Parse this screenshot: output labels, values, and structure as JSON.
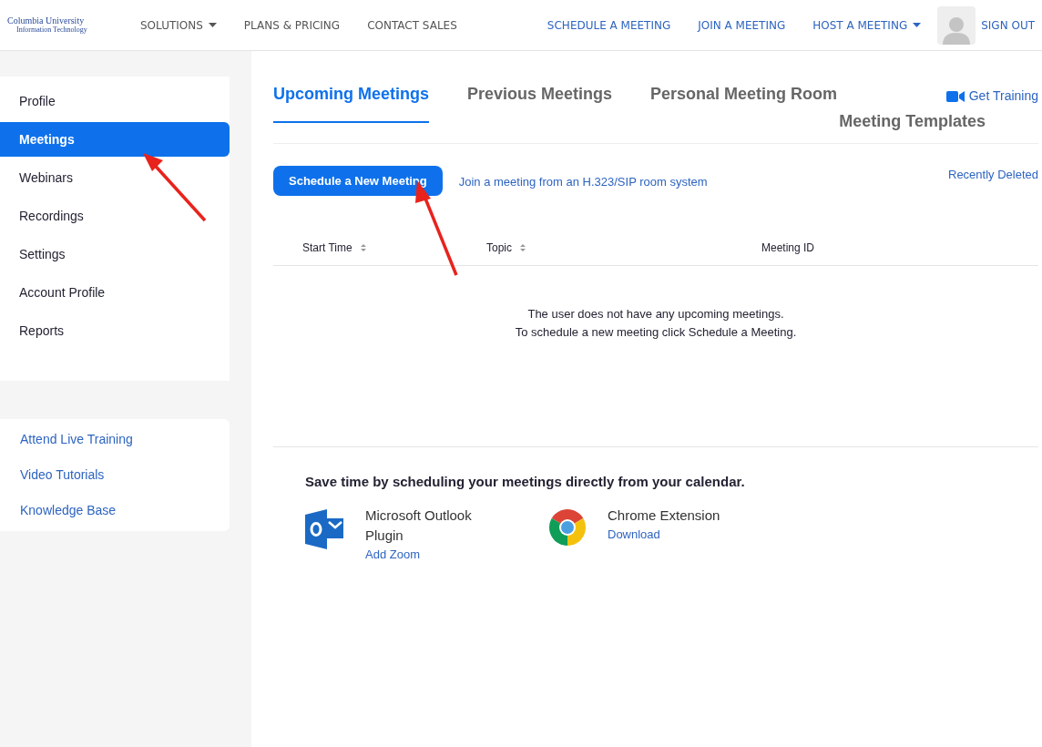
{
  "header": {
    "logo": {
      "name": "Columbia University",
      "subtitle": "Information Technology"
    },
    "left_nav": [
      {
        "label": "SOLUTIONS",
        "dropdown": true
      },
      {
        "label": "PLANS & PRICING",
        "dropdown": false
      },
      {
        "label": "CONTACT SALES",
        "dropdown": false
      }
    ],
    "right_nav": [
      {
        "label": "SCHEDULE A MEETING",
        "dropdown": false
      },
      {
        "label": "JOIN A MEETING",
        "dropdown": false
      },
      {
        "label": "HOST A MEETING",
        "dropdown": true
      }
    ],
    "sign_out": "SIGN OUT"
  },
  "sidebar": {
    "items": [
      {
        "label": "Profile",
        "selected": false
      },
      {
        "label": "Meetings",
        "selected": true
      },
      {
        "label": "Webinars",
        "selected": false
      },
      {
        "label": "Recordings",
        "selected": false
      },
      {
        "label": "Settings",
        "selected": false
      },
      {
        "label": "Account Profile",
        "selected": false
      },
      {
        "label": "Reports",
        "selected": false
      }
    ],
    "links": [
      "Attend Live Training",
      "Video Tutorials",
      "Knowledge Base"
    ]
  },
  "tabs": [
    {
      "label": "Upcoming Meetings",
      "selected": true
    },
    {
      "label": "Previous Meetings",
      "selected": false
    },
    {
      "label": "Personal Meeting Room",
      "selected": false
    },
    {
      "label": "Meeting Templates",
      "selected": false
    }
  ],
  "get_training": "Get Training",
  "schedule_button": "Schedule a New Meeting",
  "join_link": "Join a meeting from an H.323/SIP room system",
  "recently_deleted": "Recently Deleted",
  "table": {
    "columns": [
      {
        "label": "Start Time",
        "sortable": true
      },
      {
        "label": "Topic",
        "sortable": true
      },
      {
        "label": "Meeting ID",
        "sortable": false
      }
    ],
    "empty_message": [
      "The user does not have any upcoming meetings.",
      "To schedule a new meeting click Schedule a Meeting."
    ]
  },
  "calendar": {
    "heading": "Save time by scheduling your meetings directly from your calendar.",
    "integrations": [
      {
        "kind": "outlook",
        "title": "Microsoft Outlook Plugin",
        "link": "Add Zoom"
      },
      {
        "kind": "chrome",
        "title": "Chrome Extension",
        "link": "Download"
      }
    ]
  }
}
